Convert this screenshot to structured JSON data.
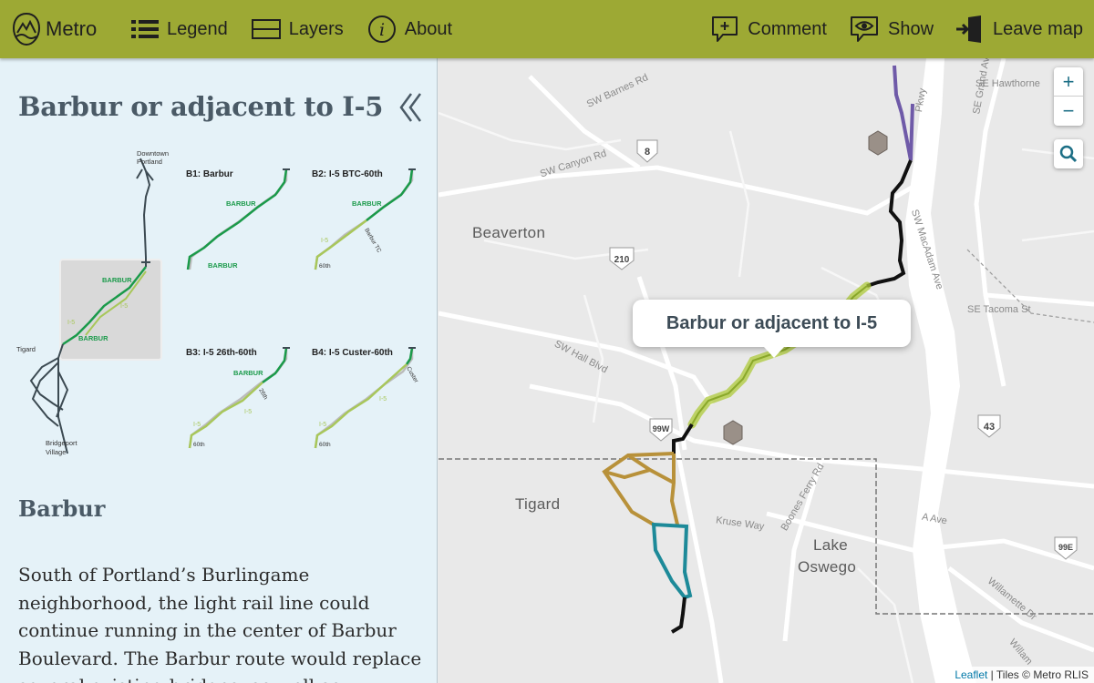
{
  "topbar": {
    "brand": "Metro",
    "nav": [
      {
        "label": "Legend",
        "icon": "list-icon"
      },
      {
        "label": "Layers",
        "icon": "layers-icon"
      },
      {
        "label": "About",
        "icon": "info-icon"
      }
    ],
    "actions": [
      {
        "label": "Comment",
        "icon": "comment-icon"
      },
      {
        "label": "Show",
        "icon": "eye-icon"
      },
      {
        "label": "Leave map",
        "icon": "exit-icon"
      }
    ]
  },
  "sidebar": {
    "title": "Barbur or adjacent to I-5",
    "diagram": {
      "overview": {
        "top_label_1": "Downtown",
        "top_label_2": "Portland",
        "left_label": "Tigard",
        "bottom_label_1": "Bridgeport",
        "bottom_label_2": "Village",
        "barbur_1": "BARBUR",
        "barbur_2": "BARBUR",
        "i5": "I-5",
        "i5b": "I-5"
      },
      "panels": [
        {
          "title": "B1: Barbur",
          "labels": [
            "BARBUR",
            "BARBUR"
          ]
        },
        {
          "title": "B2: I-5 BTC-60th",
          "labels": [
            "BARBUR",
            "I-5",
            "Barbur TC",
            "60th"
          ]
        },
        {
          "title": "B3: I-5 26th-60th",
          "labels": [
            "BARBUR",
            "26th",
            "I-5",
            "I-5",
            "60th"
          ]
        },
        {
          "title": "B4: I-5 Custer-60th",
          "labels": [
            "Custer",
            "I-5",
            "I-5",
            "60th"
          ]
        }
      ]
    },
    "section_heading": "Barbur",
    "body": "South of Portland’s Burlingame neighborhood, the light rail line could continue running in the center of Barbur Boulevard.  The Barbur route would replace several existing bridges, as well as"
  },
  "map": {
    "cities": [
      "Beaverton",
      "Tigard",
      "Lake",
      "Oswego"
    ],
    "streets": [
      "SW Barnes Rd",
      "SW Canyon Rd",
      "SW Hall Blvd",
      "Kruse Way",
      "Boones Ferry Rd",
      "A Ave",
      "SW MacAdam Ave",
      "SE Hawthorne",
      "SE Tacoma St",
      "SE Grand Av",
      "Willamette Dr",
      "Willam",
      "Pkwy"
    ],
    "shields": [
      "8",
      "210",
      "99W",
      "43",
      "99E"
    ],
    "popup": "Barbur or adjacent to I-5",
    "zoom_in": "+",
    "zoom_out": "−",
    "attribution_link": "Leaflet",
    "attribution_text": " | Tiles © Metro RLIS",
    "colors": {
      "green_route": "#aec93a",
      "black_route": "#111111",
      "gold_route": "#b8913a",
      "teal_route": "#1d8a99",
      "purple_route": "#6f5aa8"
    }
  }
}
